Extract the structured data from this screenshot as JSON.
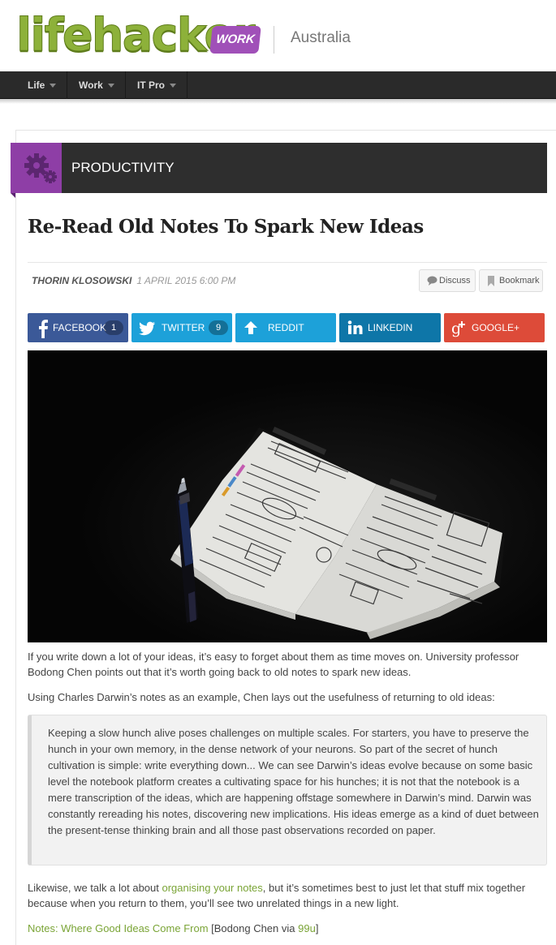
{
  "site": {
    "logo_text": "lifehacker",
    "section_badge": "WORK",
    "region": "Australia"
  },
  "nav": {
    "items": [
      {
        "label": "Life"
      },
      {
        "label": "Work"
      },
      {
        "label": "IT Pro"
      }
    ]
  },
  "category": {
    "label": "PRODUCTIVITY",
    "icon": "gears-icon",
    "accent": "#8e3ea6"
  },
  "article": {
    "title": "Re-Read Old Notes To Spark New Ideas",
    "author": "THORIN KLOSOWSKI",
    "date": "1 APRIL 2015 6:00 PM",
    "discuss_label": "Discuss",
    "bookmark_label": "Bookmark"
  },
  "share": {
    "facebook": {
      "label": "FACEBOOK",
      "count": "1",
      "color": "#3b5998"
    },
    "twitter": {
      "label": "TWITTER",
      "count": "9",
      "color": "#1da1d9"
    },
    "reddit": {
      "label": "REDDIT",
      "color": "#1da1d9"
    },
    "linkedin": {
      "label": "LINKEDIN",
      "color": "#0e76a8"
    },
    "googleplus": {
      "label": "GOOGLE+",
      "color": "#dd4b39"
    }
  },
  "body": {
    "p1": "If you write down a lot of your ideas, it’s easy to forget about them as time moves on. University professor Bodong Chen points out that it’s worth going back to old notes to spark new ideas.",
    "p2": "Using Charles Darwin’s notes as an example, Chen lays out the usefulness of returning to old ideas:",
    "quote": "Keeping a slow hunch alive poses challenges on multiple scales. For starters, you have to preserve the hunch in your own memory, in the dense network of your neurons. So part of the secret of hunch cultivation is simple: write everything down... We can see Darwin’s ideas evolve because on some basic level the notebook platform creates a cultivating space for his hunches; it is not that the notebook is a mere transcription of the ideas, which are happening offstage somewhere in Darwin’s mind. Darwin was constantly rereading his notes, discovering new implications. His ideas emerge as a kind of duet between the present-tense thinking brain and all those past observations recorded on paper.",
    "p3_before": "Likewise, we talk a lot about ",
    "p3_link": "organising your notes",
    "p3_after": ", but it’s sometimes best to just let that stuff mix together because when you return to them, you’ll see two unrelated things in a new light.",
    "source_link": "Notes: Where Good Ideas Come From",
    "source_open": " [Bodong Chen via ",
    "source_via": "99u",
    "source_close": "]"
  }
}
